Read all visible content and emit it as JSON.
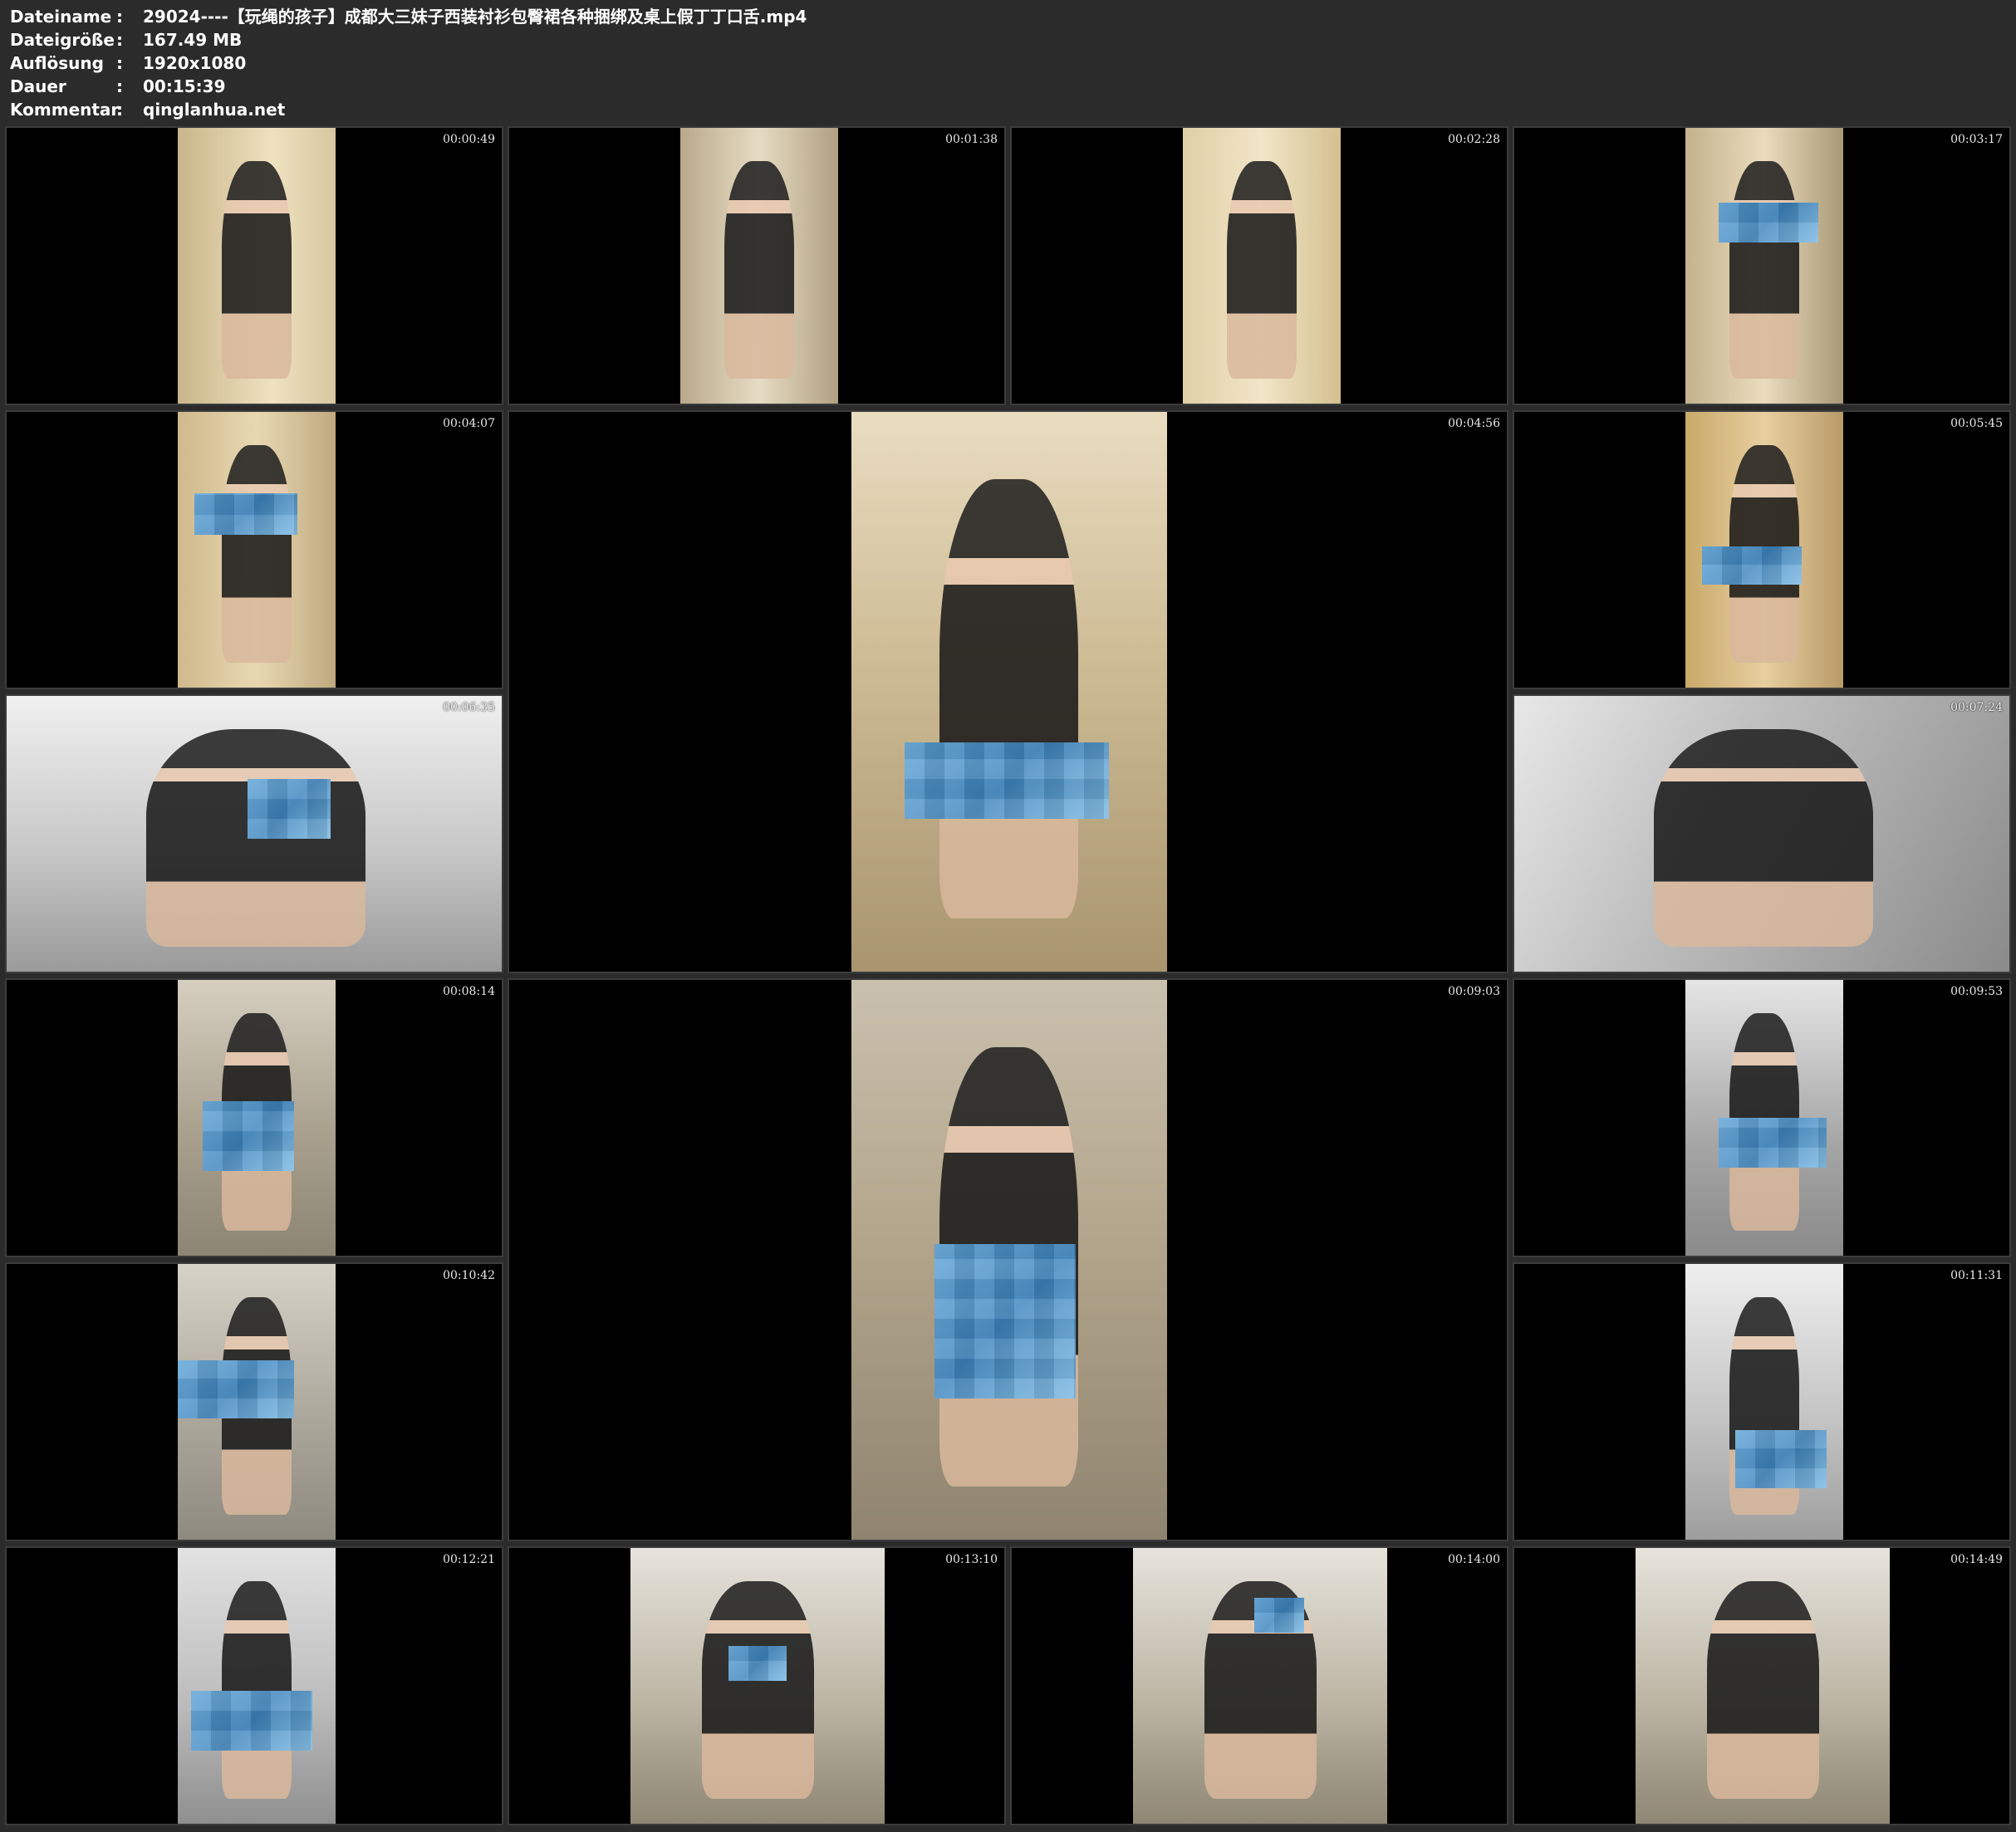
{
  "meta": {
    "rows": [
      {
        "key": "Dateiname",
        "sep": ":",
        "value": "29024----【玩绳的孩子】成都大三妹子西装衬衫包臀裙各种捆绑及桌上假丁丁口舌.mp4"
      },
      {
        "key": "Dateigröße",
        "sep": ":",
        "value": "167.49 MB"
      },
      {
        "key": "Auflösung",
        "sep": ":",
        "value": "1920x1080"
      },
      {
        "key": "Dauer",
        "sep": ":",
        "value": "00:15:39"
      },
      {
        "key": "Kommentar",
        "sep": ":",
        "value": "qinglanhua.net"
      }
    ]
  },
  "thumbnails": [
    {
      "time": "00:00:49"
    },
    {
      "time": "00:01:38"
    },
    {
      "time": "00:02:28"
    },
    {
      "time": "00:03:17"
    },
    {
      "time": "00:04:07"
    },
    {
      "time": "00:04:56"
    },
    {
      "time": "00:05:45"
    },
    {
      "time": "00:06:35"
    },
    {
      "time": "00:07:24"
    },
    {
      "time": "00:08:14"
    },
    {
      "time": "00:09:03"
    },
    {
      "time": "00:09:53"
    },
    {
      "time": "00:10:42"
    },
    {
      "time": "00:11:31"
    },
    {
      "time": "00:12:21"
    },
    {
      "time": "00:13:10"
    },
    {
      "time": "00:14:00"
    },
    {
      "time": "00:14:49"
    }
  ],
  "colors": {
    "background": "#2b2b2b",
    "tile_bg": "#000000",
    "mosaic": "#4a90c8",
    "text": "#ffffff"
  }
}
